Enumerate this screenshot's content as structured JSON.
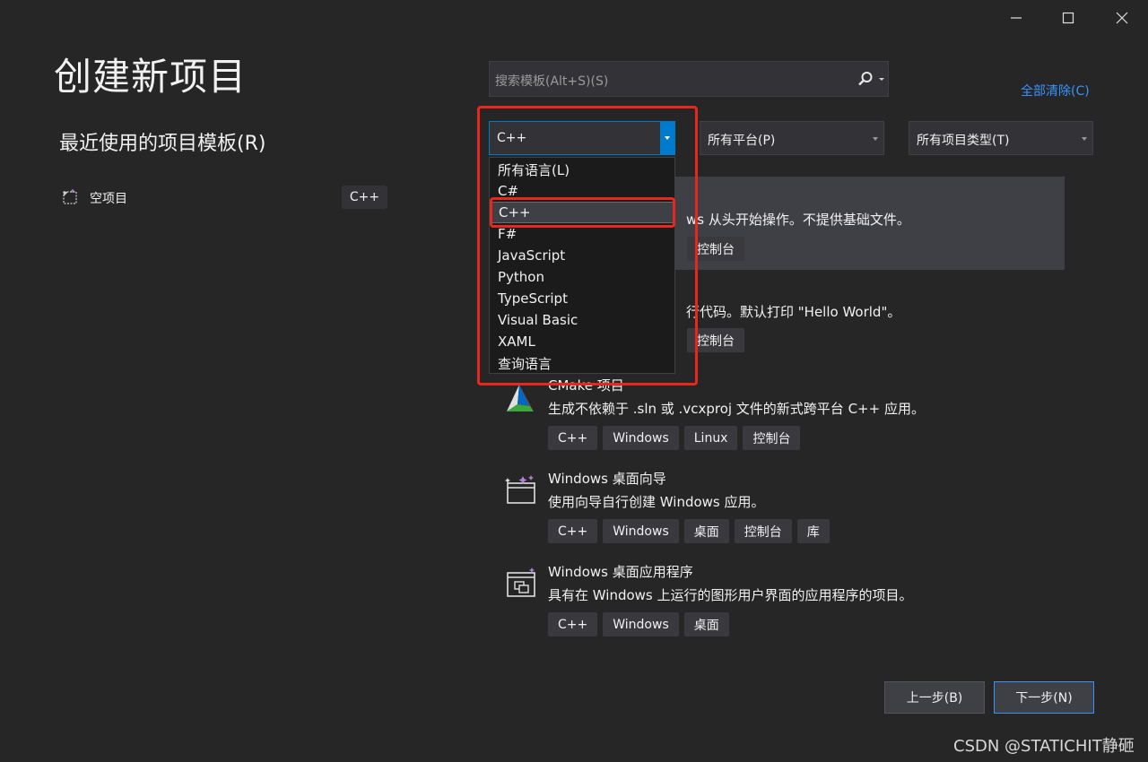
{
  "window": {
    "controls": [
      {
        "name": "minimize",
        "icon": "minimize-icon"
      },
      {
        "name": "maximize",
        "icon": "maximize-icon"
      },
      {
        "name": "close",
        "icon": "close-icon"
      }
    ]
  },
  "page": {
    "title": "创建新项目",
    "recent_title": "最近使用的项目模板(R)"
  },
  "recent": [
    {
      "label": "空项目",
      "tag": "C++",
      "icon": "empty-project-icon"
    }
  ],
  "search": {
    "placeholder": "搜索模板(Alt+S)(S)",
    "icon": "search-icon"
  },
  "clear_all": "全部清除(C)",
  "filters": {
    "language": "C++",
    "platform": "所有平台(P)",
    "project_type": "所有项目类型(T)"
  },
  "language_options": [
    "所有语言(L)",
    "C#",
    "C++",
    "F#",
    "JavaScript",
    "Python",
    "TypeScript",
    "Visual Basic",
    "XAML",
    "查询语言"
  ],
  "selected_language_index": 2,
  "templates": [
    {
      "name": "",
      "desc": "ws 从头开始操作。不提供基础文件。",
      "tags": [
        "控制台"
      ],
      "selected": true
    },
    {
      "name": "",
      "desc": "行代码。默认打印 \"Hello World\"。",
      "tags": [
        "控制台"
      ],
      "selected": false
    },
    {
      "name": "CMake 项目",
      "desc": "生成不依赖于 .sln 或 .vcxproj 文件的新式跨平台 C++ 应用。",
      "tags": [
        "C++",
        "Windows",
        "Linux",
        "控制台"
      ],
      "icon": "cmake-icon"
    },
    {
      "name": "Windows 桌面向导",
      "desc": "使用向导自行创建 Windows 应用。",
      "tags": [
        "C++",
        "Windows",
        "桌面",
        "控制台",
        "库"
      ],
      "icon": "wizard-icon"
    },
    {
      "name": "Windows 桌面应用程序",
      "desc": "具有在 Windows 上运行的图形用户界面的应用程序的项目。",
      "tags": [
        "C++",
        "Windows",
        "桌面"
      ],
      "icon": "desktop-app-icon"
    }
  ],
  "buttons": {
    "prev": "上一步(B)",
    "next": "下一步(N)"
  },
  "watermark": "CSDN @STATICHIT静砸",
  "colors": {
    "accent": "#007acc",
    "link": "#3794ff",
    "highlight": "#e8281e"
  }
}
